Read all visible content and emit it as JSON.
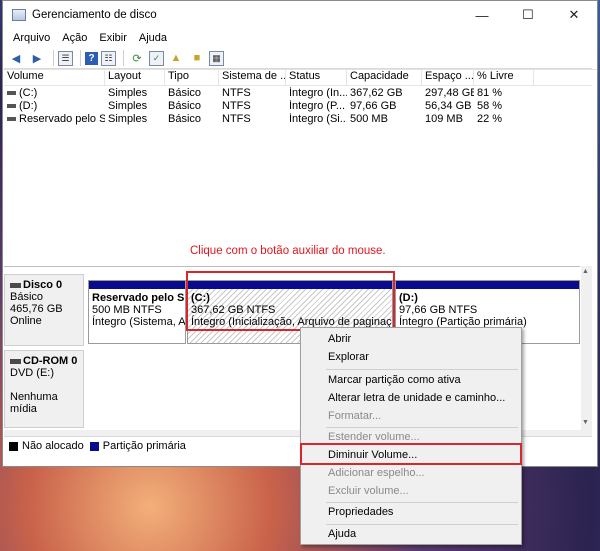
{
  "window": {
    "title": "Gerenciamento de disco"
  },
  "menu": [
    "Arquivo",
    "Ação",
    "Exibir",
    "Ajuda"
  ],
  "toolbar_icons": [
    "back-arrow-icon",
    "forward-arrow-icon",
    "list-view-icon",
    "help-icon",
    "properties-icon",
    "refresh-icon",
    "check-icon",
    "folder-up-icon",
    "folder-key-icon",
    "grid-icon"
  ],
  "table": {
    "headers": [
      "Volume",
      "Layout",
      "Tipo",
      "Sistema de ...",
      "Status",
      "Capacidade",
      "Espaço ...",
      "% Livre"
    ],
    "rows": [
      [
        "(C:)",
        "Simples",
        "Básico",
        "NTFS",
        "Íntegro (In...",
        "367,62 GB",
        "297,48 GB",
        "81 %"
      ],
      [
        "(D:)",
        "Simples",
        "Básico",
        "NTFS",
        "Íntegro (P...",
        "97,66 GB",
        "56,34 GB",
        "58 %"
      ],
      [
        "Reservado pelo Sis...",
        "Simples",
        "Básico",
        "NTFS",
        "Íntegro (Si...",
        "500 MB",
        "109 MB",
        "22 %"
      ]
    ]
  },
  "annotation": "Clique com o botão auxiliar do mouse.",
  "disk0": {
    "name": "Disco 0",
    "type": "Básico",
    "size": "465,76 GB",
    "status": "Online"
  },
  "partitions": {
    "reserved": {
      "title": "Reservado pelo Siste",
      "size": "500 MB NTFS",
      "status": "Íntegro (Sistema, Ativ"
    },
    "c": {
      "title": "(C:)",
      "size": "367,62 GB NTFS",
      "status": "Íntegro (Inicialização, Arquivo de paginação, D"
    },
    "d": {
      "title": "(D:)",
      "size": "97,66 GB NTFS",
      "status": "Íntegro (Partição primária)"
    }
  },
  "cdrom": {
    "name": "CD-ROM 0",
    "drive": "DVD (E:)",
    "media": "Nenhuma mídia"
  },
  "legend": {
    "unallocated": "Não alocado",
    "primary": "Partição primária"
  },
  "context_menu": {
    "open": "Abrir",
    "explore": "Explorar",
    "mark_active": "Marcar partição como ativa",
    "change_letter": "Alterar letra de unidade e caminho...",
    "format": "Formatar...",
    "extend": "Estender volume...",
    "shrink": "Diminuir Volume...",
    "add_mirror": "Adicionar espelho...",
    "delete": "Excluir volume...",
    "properties": "Propriedades",
    "help": "Ajuda"
  },
  "colors": {
    "primary_partition": "#0a0a8c",
    "unallocated": "#000000",
    "highlight_red": "#d7262d",
    "annotation_red": "#e0161e"
  }
}
